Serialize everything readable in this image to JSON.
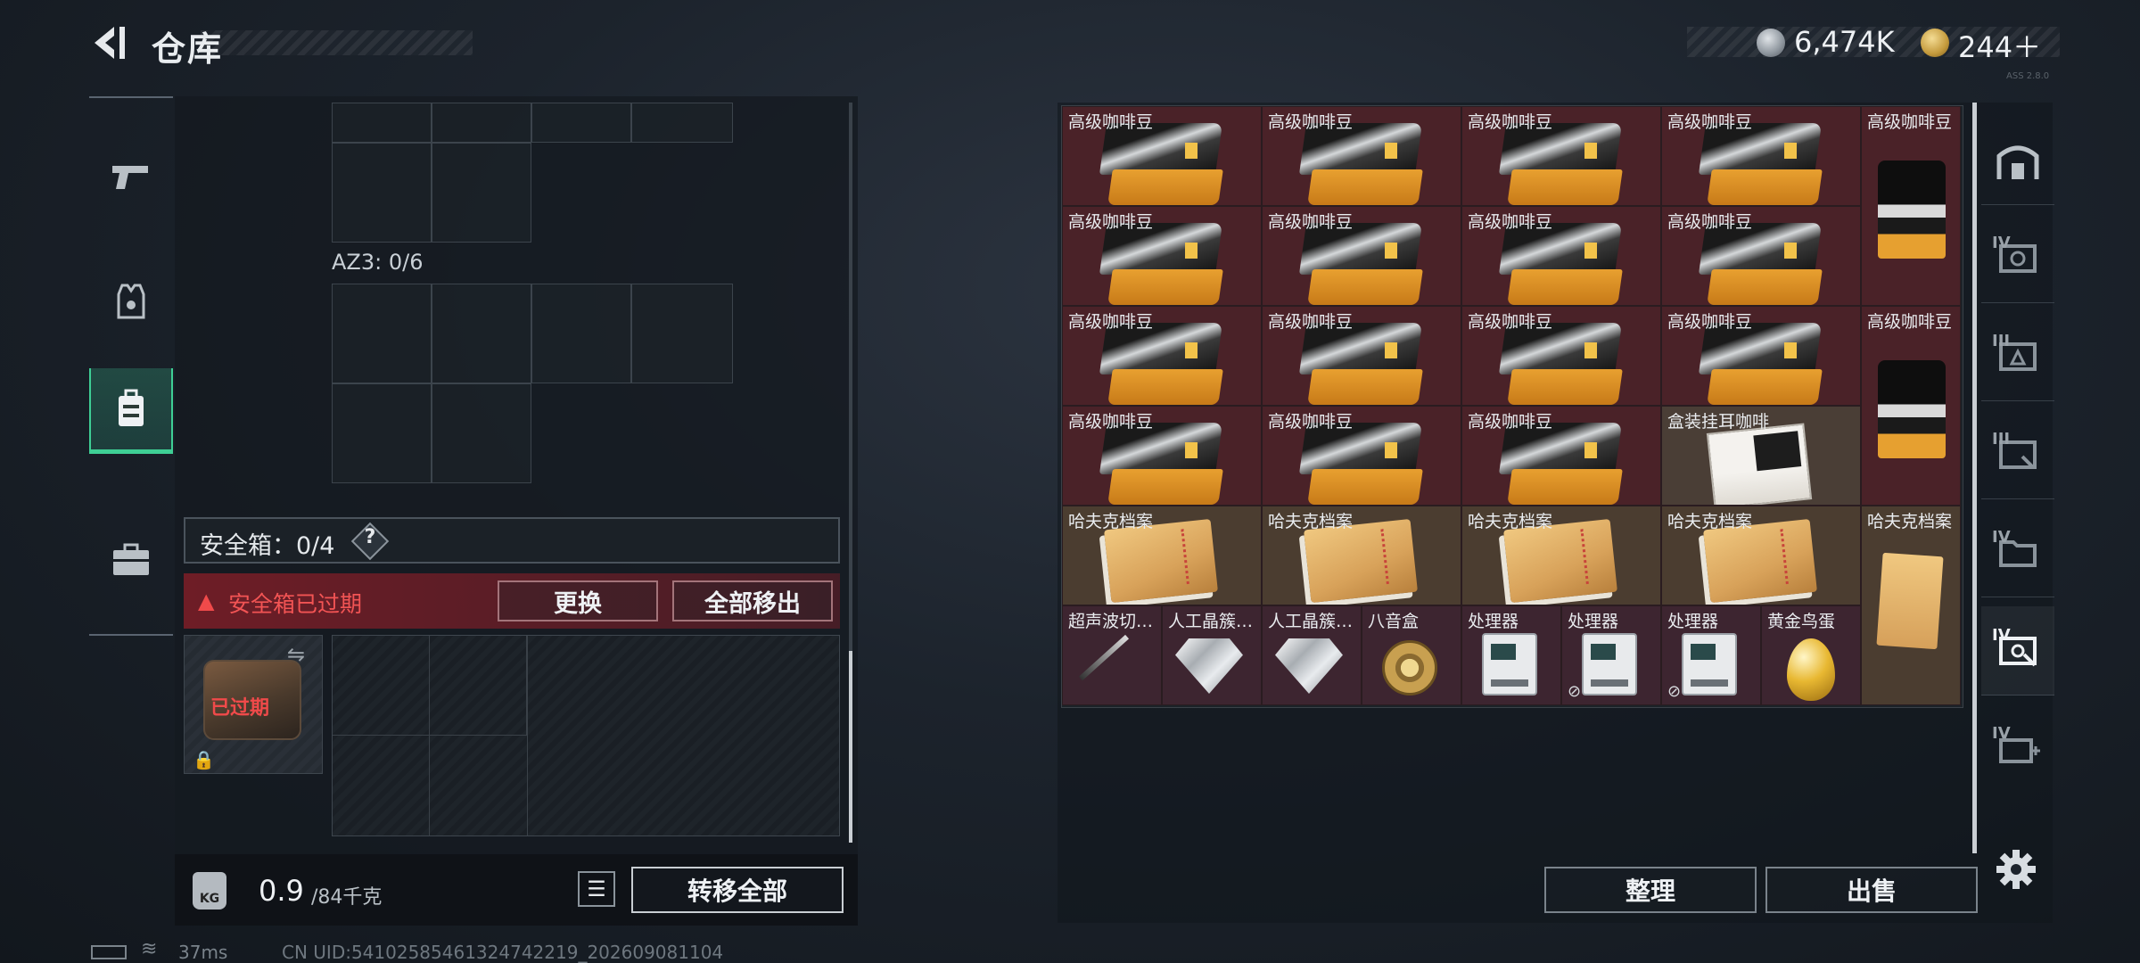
{
  "header": {
    "title": "仓库",
    "currency_silver": "6,474K",
    "currency_gold": "244＋",
    "tiny_code": "ASS 2.8.0"
  },
  "left_panel": {
    "az3_label": "AZ3: 0/6",
    "safebox_label": "安全箱：0/4",
    "help_symbol": "?",
    "expired_warning": "安全箱已过期",
    "replace_button": "更换",
    "move_all_button": "全部移出",
    "thumb_expired": "已过期",
    "weight_icon_label": "KG",
    "weight_current": "0.9",
    "weight_max": "/84千克",
    "transfer_all_button": "转移全部"
  },
  "status": {
    "ping": "37ms",
    "uid": "CN UID:5410258546132474221​9_202609081104"
  },
  "stash": {
    "rows": [
      [
        {
          "name": "高级咖啡豆",
          "kind": "coffee"
        },
        {
          "name": "高级咖啡豆",
          "kind": "coffee"
        },
        {
          "name": "高级咖啡豆",
          "kind": "coffee"
        },
        {
          "name": "高级咖啡豆",
          "kind": "coffee"
        }
      ],
      [
        {
          "name": "高级咖啡豆",
          "kind": "coffee"
        },
        {
          "name": "高级咖啡豆",
          "kind": "coffee"
        },
        {
          "name": "高级咖啡豆",
          "kind": "coffee"
        },
        {
          "name": "高级咖啡豆",
          "kind": "coffee"
        }
      ],
      [
        {
          "name": "高级咖啡豆",
          "kind": "coffee"
        },
        {
          "name": "高级咖啡豆",
          "kind": "coffee"
        },
        {
          "name": "高级咖啡豆",
          "kind": "coffee"
        },
        {
          "name": "高级咖啡豆",
          "kind": "coffee"
        }
      ],
      [
        {
          "name": "高级咖啡豆",
          "kind": "coffee"
        },
        {
          "name": "高级咖啡豆",
          "kind": "coffee"
        },
        {
          "name": "高级咖啡豆",
          "kind": "coffee"
        },
        {
          "name": "盒装挂耳咖啡",
          "kind": "boxcoffee"
        }
      ],
      [
        {
          "name": "哈夫克档案",
          "kind": "hafuke"
        },
        {
          "name": "哈夫克档案",
          "kind": "hafuke"
        },
        {
          "name": "哈夫克档案",
          "kind": "hafuke"
        },
        {
          "name": "哈夫克档案",
          "kind": "hafuke"
        }
      ]
    ],
    "tall_items": [
      {
        "name": "高级咖啡豆",
        "kind": "coffee"
      },
      {
        "name": "高级咖啡豆",
        "kind": "coffee"
      },
      {
        "name": "哈夫克档案",
        "kind": "hafuke"
      }
    ],
    "bottom_row": [
      {
        "name": "超声波切…",
        "kind": "scalpel"
      },
      {
        "name": "人工晶簇…",
        "kind": "diamond"
      },
      {
        "name": "人工晶簇…",
        "kind": "diamond"
      },
      {
        "name": "八音盒",
        "kind": "musicbox"
      },
      {
        "name": "处理器",
        "kind": "processor"
      },
      {
        "name": "处理器",
        "kind": "processor"
      },
      {
        "name": "处理器",
        "kind": "processor"
      },
      {
        "name": "黄金鸟蛋",
        "kind": "egg"
      }
    ],
    "sort_button": "整理",
    "sell_button": "出售"
  },
  "right_tabs": [
    "IV",
    "III",
    "III",
    "IV",
    "IV",
    "IV"
  ]
}
